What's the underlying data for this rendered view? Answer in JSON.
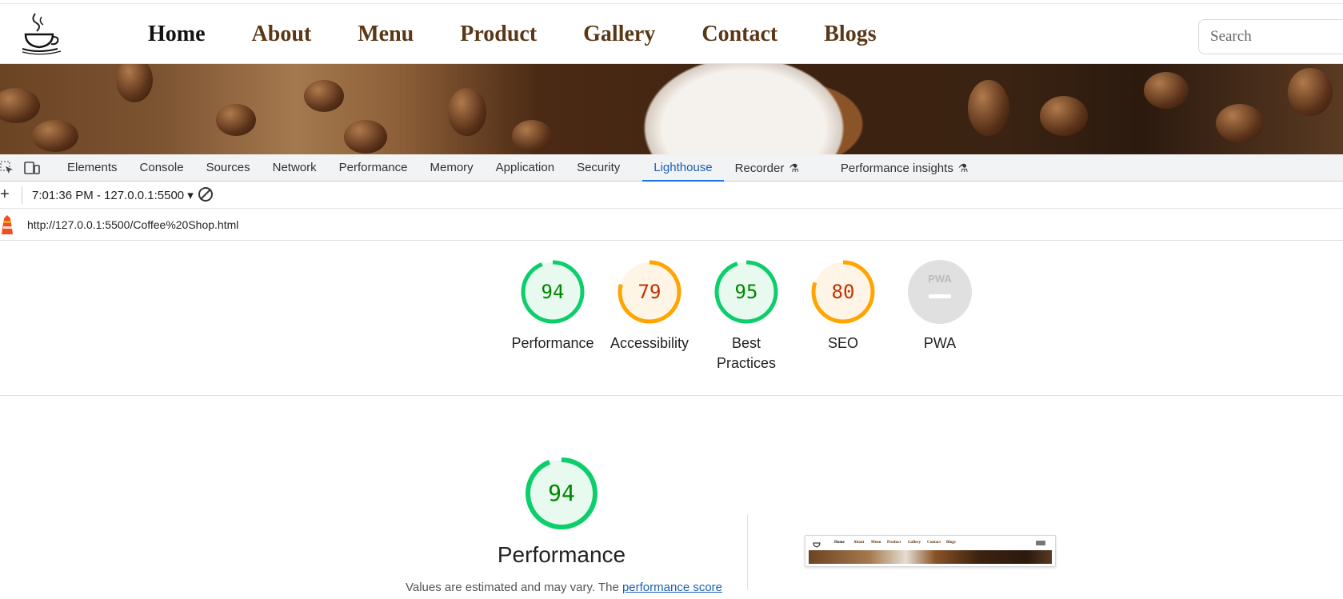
{
  "site": {
    "nav": [
      "Home",
      "About",
      "Menu",
      "Product",
      "Gallery",
      "Contact",
      "Blogs"
    ],
    "active": "Home",
    "search_placeholder": "Search",
    "logo_text": "Coffee"
  },
  "devtools": {
    "tabs": [
      "Elements",
      "Console",
      "Sources",
      "Network",
      "Performance",
      "Memory",
      "Application",
      "Security",
      "Lighthouse",
      "Recorder",
      "Performance insights"
    ],
    "active_tab": "Lighthouse",
    "report_select": "7:01:36 PM - 127.0.0.1:5500 ▾",
    "url": "http://127.0.0.1:5500/Coffee%20Shop.html"
  },
  "scores": [
    {
      "label": "Performance",
      "value": "94",
      "status": "pass"
    },
    {
      "label": "Accessibility",
      "value": "79",
      "status": "average"
    },
    {
      "label": "Best Practices",
      "value": "95",
      "status": "pass"
    },
    {
      "label": "SEO",
      "value": "80",
      "status": "average"
    },
    {
      "label": "PWA",
      "value": "",
      "status": "na"
    }
  ],
  "pwa_badge": "PWA",
  "performance": {
    "score": "94",
    "title": "Performance",
    "note_prefix": "Values are estimated and may vary. The ",
    "note_link": "performance score"
  },
  "colors": {
    "pass": "#0cce6b",
    "pass_text": "#008800",
    "pass_bg": "#e8f9ef",
    "average": "#ffa400",
    "average_text": "#c33300",
    "average_bg": "#fff5e6",
    "na": "#e0e0e0",
    "nav_brown": "#5a3716",
    "accent": "#1a73e8"
  }
}
